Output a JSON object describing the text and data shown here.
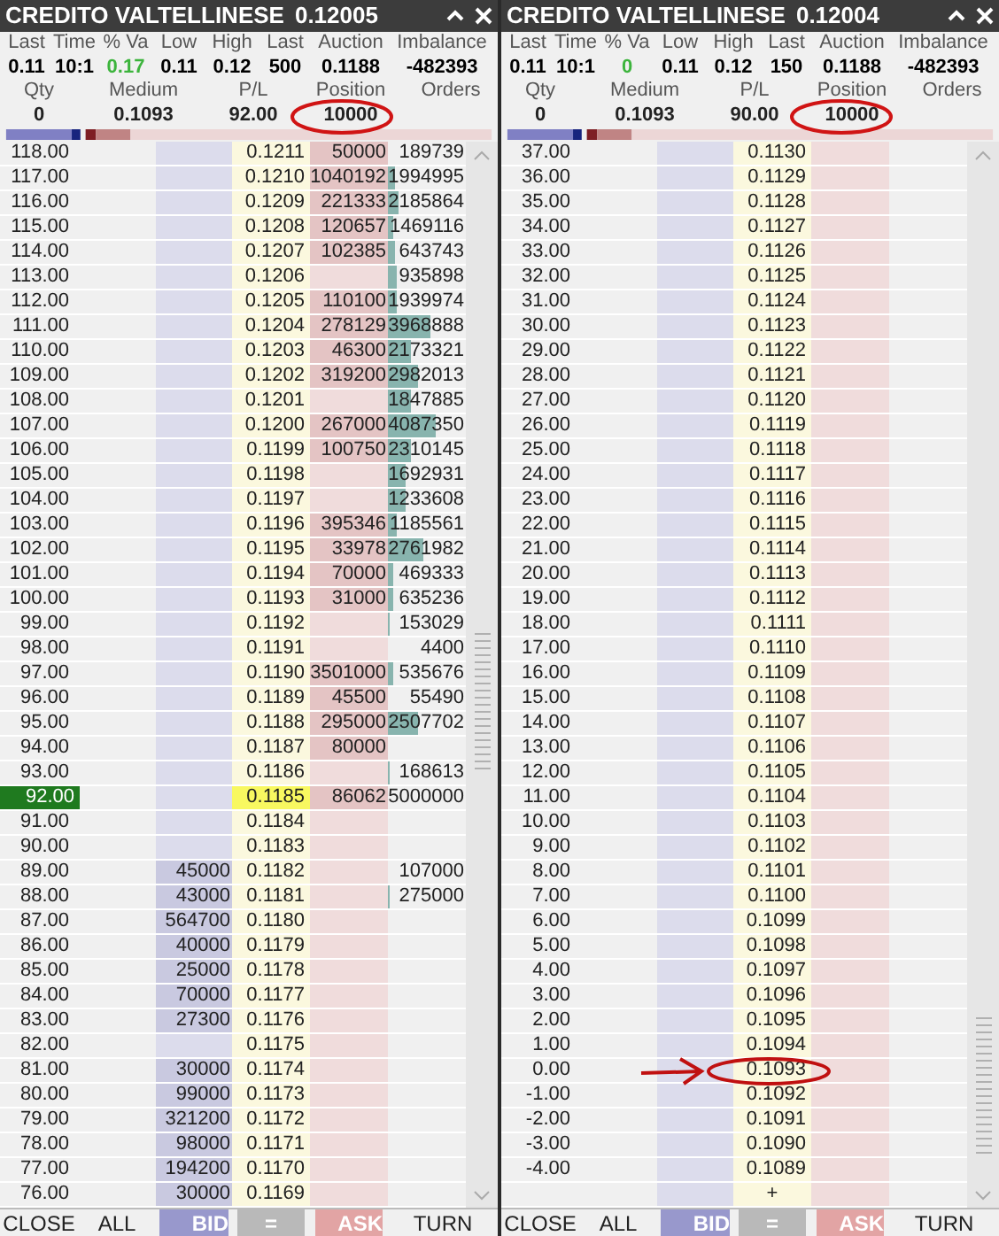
{
  "panels": [
    {
      "title": "CREDITO VALTELLINESE",
      "price": "0.12005",
      "stats": [
        {
          "label": "Last",
          "value": "0.11",
          "color": "#000000"
        },
        {
          "label": "Time",
          "value": "10:1",
          "color": "#000000"
        },
        {
          "label": "% Va",
          "value": "0.17",
          "color": "#3cb43c"
        },
        {
          "label": "Low",
          "value": "0.11",
          "color": "#000000"
        },
        {
          "label": "High",
          "value": "0.12",
          "color": "#000000"
        },
        {
          "label": "Last",
          "value": "500",
          "color": "#000000"
        },
        {
          "label": "Auction",
          "value": "0.1188",
          "color": "#000000"
        },
        {
          "label": "Imbalance",
          "value": "-482393",
          "color": "#000000"
        }
      ],
      "summary": [
        {
          "label": "Qty",
          "value": "0"
        },
        {
          "label": "Medium",
          "value": "0.1093"
        },
        {
          "label": "P/L",
          "value": "92.00"
        },
        {
          "label": "Position",
          "value": "10000"
        },
        {
          "label": "Orders"
        }
      ],
      "rows": [
        {
          "pl": "118.00",
          "price": "0.1211",
          "ask": "50000",
          "orders": "189739",
          "current": false
        },
        {
          "pl": "117.00",
          "price": "0.1210",
          "ask": "1040192",
          "orders": "1994995",
          "current": false
        },
        {
          "pl": "116.00",
          "price": "0.1209",
          "ask": "221333",
          "orders": "2185864",
          "current": false
        },
        {
          "pl": "115.00",
          "price": "0.1208",
          "ask": "120657",
          "orders": "1469116",
          "current": false
        },
        {
          "pl": "114.00",
          "price": "0.1207",
          "ask": "102385",
          "orders": "643743",
          "current": false
        },
        {
          "pl": "113.00",
          "price": "0.1206",
          "orders": "935898",
          "current": false
        },
        {
          "pl": "112.00",
          "price": "0.1205",
          "ask": "110100",
          "orders": "1939974",
          "current": false
        },
        {
          "pl": "111.00",
          "price": "0.1204",
          "ask": "278129",
          "orders": "3968888",
          "current": false
        },
        {
          "pl": "110.00",
          "price": "0.1203",
          "ask": "46300",
          "orders": "2173321",
          "current": false
        },
        {
          "pl": "109.00",
          "price": "0.1202",
          "ask": "319200",
          "orders": "2982013",
          "current": false
        },
        {
          "pl": "108.00",
          "price": "0.1201",
          "orders": "1847885",
          "current": false
        },
        {
          "pl": "107.00",
          "price": "0.1200",
          "ask": "267000",
          "orders": "4087350",
          "current": false
        },
        {
          "pl": "106.00",
          "price": "0.1199",
          "ask": "100750",
          "orders": "2310145",
          "current": false
        },
        {
          "pl": "105.00",
          "price": "0.1198",
          "orders": "1692931",
          "current": false
        },
        {
          "pl": "104.00",
          "price": "0.1197",
          "orders": "1233608",
          "current": false
        },
        {
          "pl": "103.00",
          "price": "0.1196",
          "ask": "395346",
          "orders": "1185561",
          "current": false
        },
        {
          "pl": "102.00",
          "price": "0.1195",
          "ask": "33978",
          "orders": "2761982",
          "current": false
        },
        {
          "pl": "101.00",
          "price": "0.1194",
          "ask": "70000",
          "orders": "469333",
          "current": false
        },
        {
          "pl": "100.00",
          "price": "0.1193",
          "ask": "31000",
          "orders": "635236",
          "current": false
        },
        {
          "pl": "99.00",
          "price": "0.1192",
          "orders": "153029",
          "current": false
        },
        {
          "pl": "98.00",
          "price": "0.1191",
          "orders": "4400",
          "current": false
        },
        {
          "pl": "97.00",
          "price": "0.1190",
          "ask": "3501000",
          "orders": "535676",
          "current": false
        },
        {
          "pl": "96.00",
          "price": "0.1189",
          "ask": "45500",
          "orders": "55490",
          "current": false
        },
        {
          "pl": "95.00",
          "price": "0.1188",
          "ask": "295000",
          "orders": "2507702",
          "current": false
        },
        {
          "pl": "94.00",
          "price": "0.1187",
          "ask": "80000",
          "current": false
        },
        {
          "pl": "93.00",
          "price": "0.1186",
          "orders": "168613",
          "current": false
        },
        {
          "pl": "92.00",
          "price": "0.1185",
          "ask": "86062",
          "orders": "5000000",
          "current": true
        },
        {
          "pl": "91.00",
          "price": "0.1184",
          "current": false
        },
        {
          "pl": "90.00",
          "price": "0.1183",
          "current": false
        },
        {
          "pl": "89.00",
          "bid": "45000",
          "price": "0.1182",
          "orders": "107000",
          "current": false
        },
        {
          "pl": "88.00",
          "bid": "43000",
          "price": "0.1181",
          "orders": "275000",
          "current": false
        },
        {
          "pl": "87.00",
          "bid": "564700",
          "price": "0.1180",
          "current": false
        },
        {
          "pl": "86.00",
          "bid": "40000",
          "price": "0.1179",
          "current": false
        },
        {
          "pl": "85.00",
          "bid": "25000",
          "price": "0.1178",
          "current": false
        },
        {
          "pl": "84.00",
          "bid": "70000",
          "price": "0.1177",
          "current": false
        },
        {
          "pl": "83.00",
          "bid": "27300",
          "price": "0.1176",
          "current": false
        },
        {
          "pl": "82.00",
          "price": "0.1175",
          "current": false
        },
        {
          "pl": "81.00",
          "bid": "30000",
          "price": "0.1174",
          "current": false
        },
        {
          "pl": "80.00",
          "bid": "99000",
          "price": "0.1173",
          "current": false
        },
        {
          "pl": "79.00",
          "bid": "321200",
          "price": "0.1172",
          "current": false
        },
        {
          "pl": "78.00",
          "bid": "98000",
          "price": "0.1171",
          "current": false
        },
        {
          "pl": "77.00",
          "bid": "194200",
          "price": "0.1170",
          "current": false
        },
        {
          "pl": "76.00",
          "bid": "30000",
          "price": "0.1169",
          "current": false
        }
      ],
      "buttons": [
        {
          "label": "CLOSE",
          "kind": "plain"
        },
        {
          "label": "ALL",
          "kind": "plain"
        },
        {
          "label": "BID",
          "kind": "bid"
        },
        {
          "label": "=",
          "kind": "neutral"
        },
        {
          "label": "ASK",
          "kind": "ask"
        },
        {
          "label": "TURN",
          "kind": "plain"
        }
      ]
    },
    {
      "title": "CREDITO VALTELLINESE",
      "price": "0.12004",
      "stats": [
        {
          "label": "Last",
          "value": "0.11",
          "color": "#000000"
        },
        {
          "label": "Time",
          "value": "10:1",
          "color": "#000000"
        },
        {
          "label": "% Va",
          "value": "0",
          "color": "#3cb43c"
        },
        {
          "label": "Low",
          "value": "0.11",
          "color": "#000000"
        },
        {
          "label": "High",
          "value": "0.12",
          "color": "#000000"
        },
        {
          "label": "Last",
          "value": "150",
          "color": "#000000"
        },
        {
          "label": "Auction",
          "value": "0.1188",
          "color": "#000000"
        },
        {
          "label": "Imbalance",
          "value": "-482393",
          "color": "#000000"
        }
      ],
      "summary": [
        {
          "label": "Qty",
          "value": "0"
        },
        {
          "label": "Medium",
          "value": "0.1093"
        },
        {
          "label": "P/L",
          "value": "90.00"
        },
        {
          "label": "Position",
          "value": "10000"
        },
        {
          "label": "Orders"
        }
      ],
      "rows": [
        {
          "pl": "37.00",
          "price": "0.1130",
          "current": false
        },
        {
          "pl": "36.00",
          "price": "0.1129",
          "current": false
        },
        {
          "pl": "35.00",
          "price": "0.1128",
          "current": false
        },
        {
          "pl": "34.00",
          "price": "0.1127",
          "current": false
        },
        {
          "pl": "33.00",
          "price": "0.1126",
          "current": false
        },
        {
          "pl": "32.00",
          "price": "0.1125",
          "current": false
        },
        {
          "pl": "31.00",
          "price": "0.1124",
          "current": false
        },
        {
          "pl": "30.00",
          "price": "0.1123",
          "current": false
        },
        {
          "pl": "29.00",
          "price": "0.1122",
          "current": false
        },
        {
          "pl": "28.00",
          "price": "0.1121",
          "current": false
        },
        {
          "pl": "27.00",
          "price": "0.1120",
          "current": false
        },
        {
          "pl": "26.00",
          "price": "0.1119",
          "current": false
        },
        {
          "pl": "25.00",
          "price": "0.1118",
          "current": false
        },
        {
          "pl": "24.00",
          "price": "0.1117",
          "current": false
        },
        {
          "pl": "23.00",
          "price": "0.1116",
          "current": false
        },
        {
          "pl": "22.00",
          "price": "0.1115",
          "current": false
        },
        {
          "pl": "21.00",
          "price": "0.1114",
          "current": false
        },
        {
          "pl": "20.00",
          "price": "0.1113",
          "current": false
        },
        {
          "pl": "19.00",
          "price": "0.1112",
          "current": false
        },
        {
          "pl": "18.00",
          "price": "0.1111",
          "current": false
        },
        {
          "pl": "17.00",
          "price": "0.1110",
          "current": false
        },
        {
          "pl": "16.00",
          "price": "0.1109",
          "current": false
        },
        {
          "pl": "15.00",
          "price": "0.1108",
          "current": false
        },
        {
          "pl": "14.00",
          "price": "0.1107",
          "current": false
        },
        {
          "pl": "13.00",
          "price": "0.1106",
          "current": false
        },
        {
          "pl": "12.00",
          "price": "0.1105",
          "current": false
        },
        {
          "pl": "11.00",
          "price": "0.1104",
          "current": false
        },
        {
          "pl": "10.00",
          "price": "0.1103",
          "current": false
        },
        {
          "pl": "9.00",
          "price": "0.1102",
          "current": false
        },
        {
          "pl": "8.00",
          "price": "0.1101",
          "current": false
        },
        {
          "pl": "7.00",
          "price": "0.1100",
          "current": false
        },
        {
          "pl": "6.00",
          "price": "0.1099",
          "current": false
        },
        {
          "pl": "5.00",
          "price": "0.1098",
          "current": false
        },
        {
          "pl": "4.00",
          "price": "0.1097",
          "current": false
        },
        {
          "pl": "3.00",
          "price": "0.1096",
          "current": false
        },
        {
          "pl": "2.00",
          "price": "0.1095",
          "current": false
        },
        {
          "pl": "1.00",
          "price": "0.1094",
          "current": false
        },
        {
          "pl": "0.00",
          "price": "0.1093",
          "current": false
        },
        {
          "pl": "-1.00",
          "price": "0.1092",
          "current": false
        },
        {
          "pl": "-2.00",
          "price": "0.1091",
          "current": false
        },
        {
          "pl": "-3.00",
          "price": "0.1090",
          "current": false
        },
        {
          "pl": "-4.00",
          "price": "0.1089",
          "current": false
        },
        {
          "price": "+",
          "current": false
        }
      ],
      "buttons": [
        {
          "label": "CLOSE",
          "kind": "plain"
        },
        {
          "label": "ALL",
          "kind": "plain"
        },
        {
          "label": "BID",
          "kind": "bid"
        },
        {
          "label": "=",
          "kind": "neutral"
        },
        {
          "label": "ASK",
          "kind": "ask"
        },
        {
          "label": "TURN",
          "kind": "plain"
        }
      ]
    }
  ]
}
